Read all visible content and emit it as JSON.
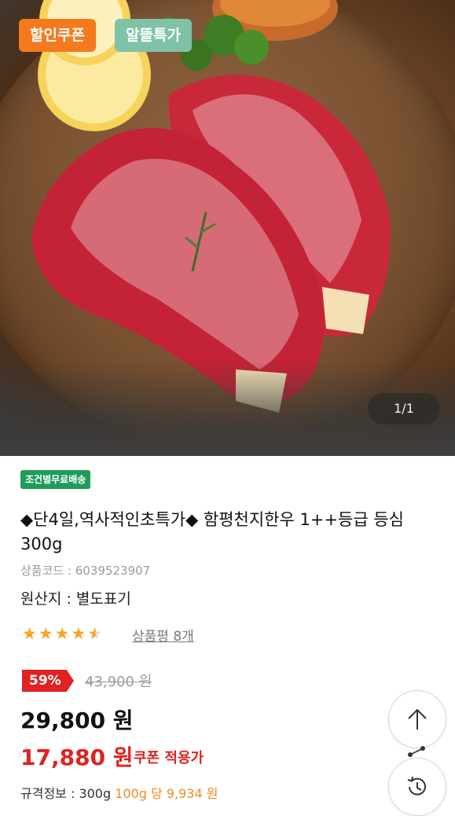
{
  "hero": {
    "badges": {
      "coupon": "할인쿠폰",
      "deal": "알뜰특가"
    },
    "page_indicator": "1/1"
  },
  "product": {
    "shipping_tag": "조건별무료배송",
    "title": "◆단4일,역사적인초특가◆ 함평천지한우 1++등급 등심 300g",
    "code": "상품코드 : 6039523907",
    "origin": "원산지 : 별도표기",
    "rating": 4.5,
    "review_link": "상품평 8개",
    "discount_rate": "59%",
    "original_price": "43,900 원",
    "sale_price": "29,800 원",
    "coupon_price": "17,880 원",
    "coupon_note": "쿠폰 적용가",
    "spec": {
      "label": "규격정보 : 300g",
      "unit": "100g 당",
      "unit_price": "9,934 원"
    }
  },
  "colors": {
    "discount": "#e02222",
    "coupon_badge": "#f47a1d",
    "deal_badge": "#7fc2a8",
    "shipping": "#1e9d5a",
    "star": "#f5a623"
  },
  "icons": {
    "scroll_top": "arrow-up-icon",
    "recent": "history-icon",
    "share": "share-icon"
  }
}
